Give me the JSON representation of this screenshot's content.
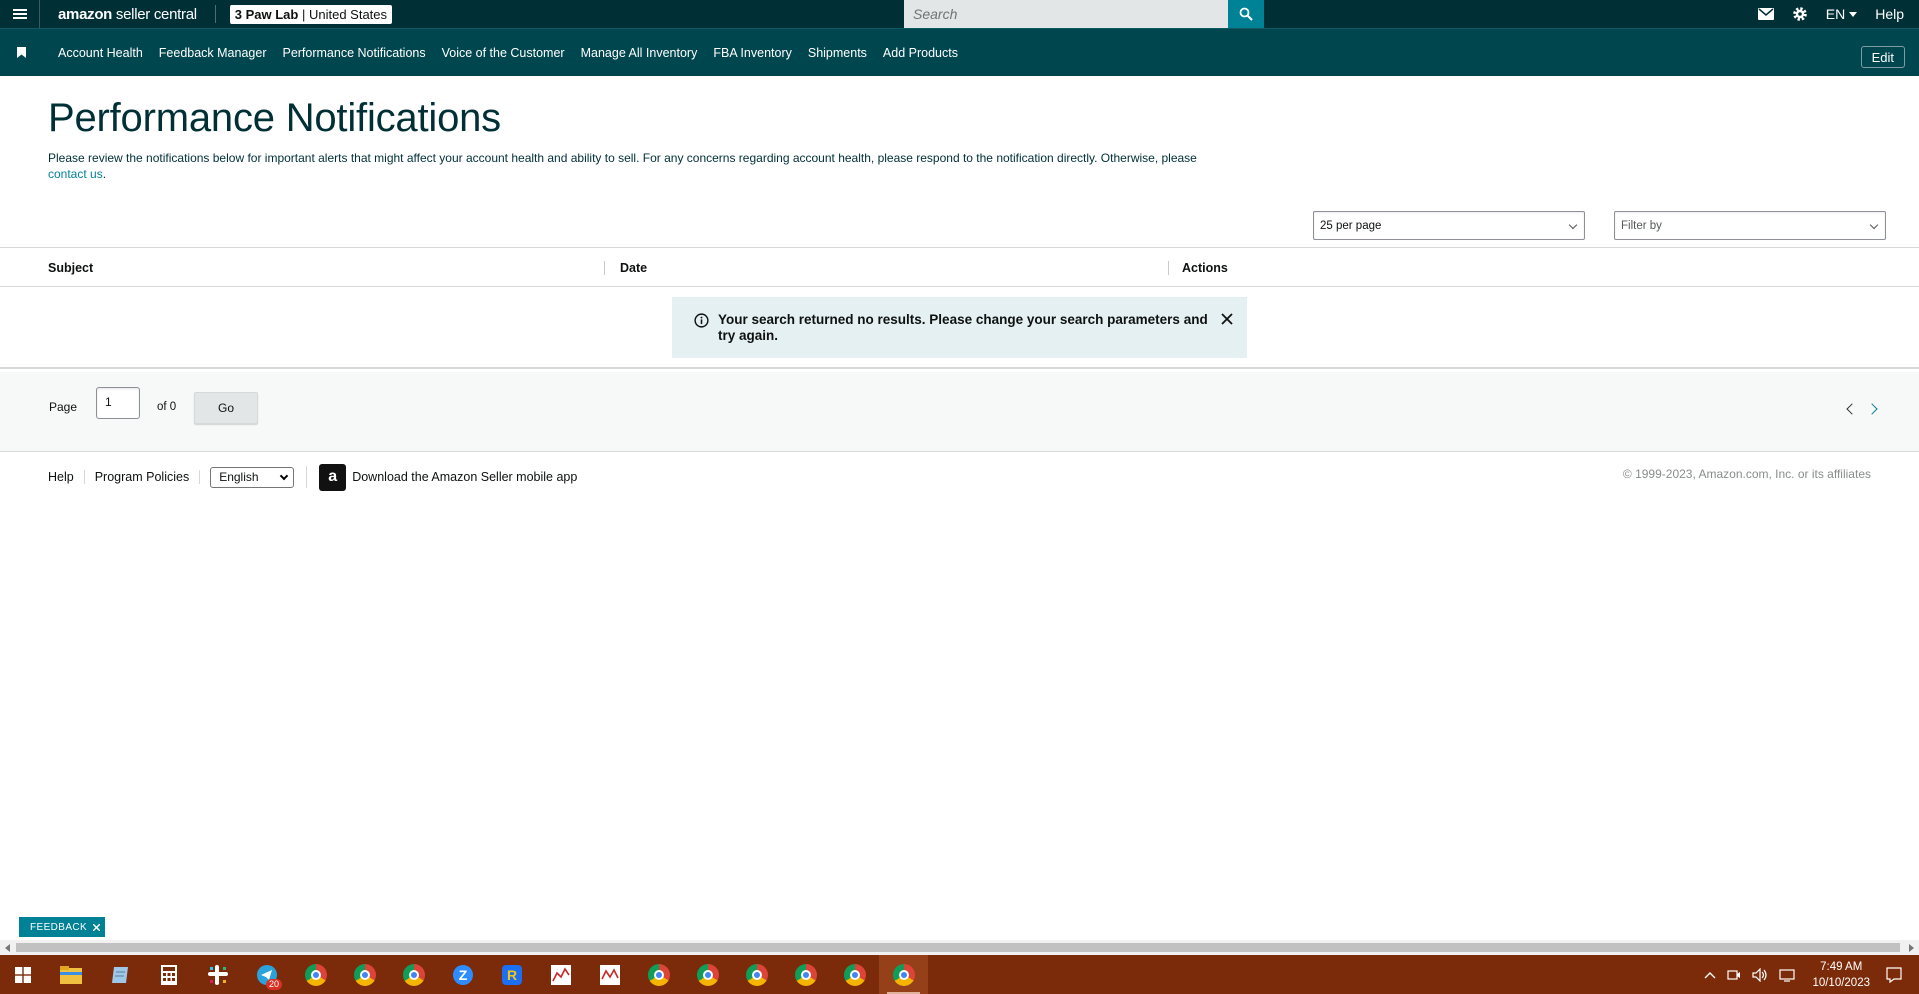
{
  "topbar": {
    "brand_amazon": "amazon",
    "brand_rest": " seller central",
    "store_name": "3 Paw Lab",
    "store_region": "United States",
    "search_placeholder": "Search",
    "language": "EN",
    "help": "Help"
  },
  "nav": {
    "items": [
      "Account Health",
      "Feedback Manager",
      "Performance Notifications",
      "Voice of the Customer",
      "Manage All Inventory",
      "FBA Inventory",
      "Shipments",
      "Add Products"
    ],
    "edit": "Edit"
  },
  "page": {
    "title": "Performance Notifications",
    "description": "Please review the notifications below for important alerts that might affect your account health and ability to sell. For any concerns regarding account health, please respond to the notification directly. Otherwise, please",
    "contact_link": "contact us",
    "per_page": "25 per page",
    "filter_placeholder": "Filter by"
  },
  "table": {
    "columns": [
      "Subject",
      "Date",
      "Actions"
    ],
    "empty_message": "Your search returned no results. Please change your search parameters and try again."
  },
  "pagination": {
    "page_label": "Page",
    "current_page": "1",
    "of_label": "of 0",
    "go_label": "Go"
  },
  "footer": {
    "help": "Help",
    "program_policies": "Program Policies",
    "language_option": "English",
    "download_app": "Download the Amazon Seller mobile app",
    "copyright": "© 1999-2023, Amazon.com, Inc. or its affiliates"
  },
  "feedback_tab": "FEEDBACK",
  "taskbar": {
    "badge_count": "20",
    "time": "7:49 AM",
    "date": "10/10/2023"
  },
  "colors": {
    "header_bg": "#002f36",
    "nav_bg": "#00464f",
    "accent": "#008296",
    "alert_bg": "#e4f0f2",
    "taskbar_bg": "#7c2b0a"
  }
}
